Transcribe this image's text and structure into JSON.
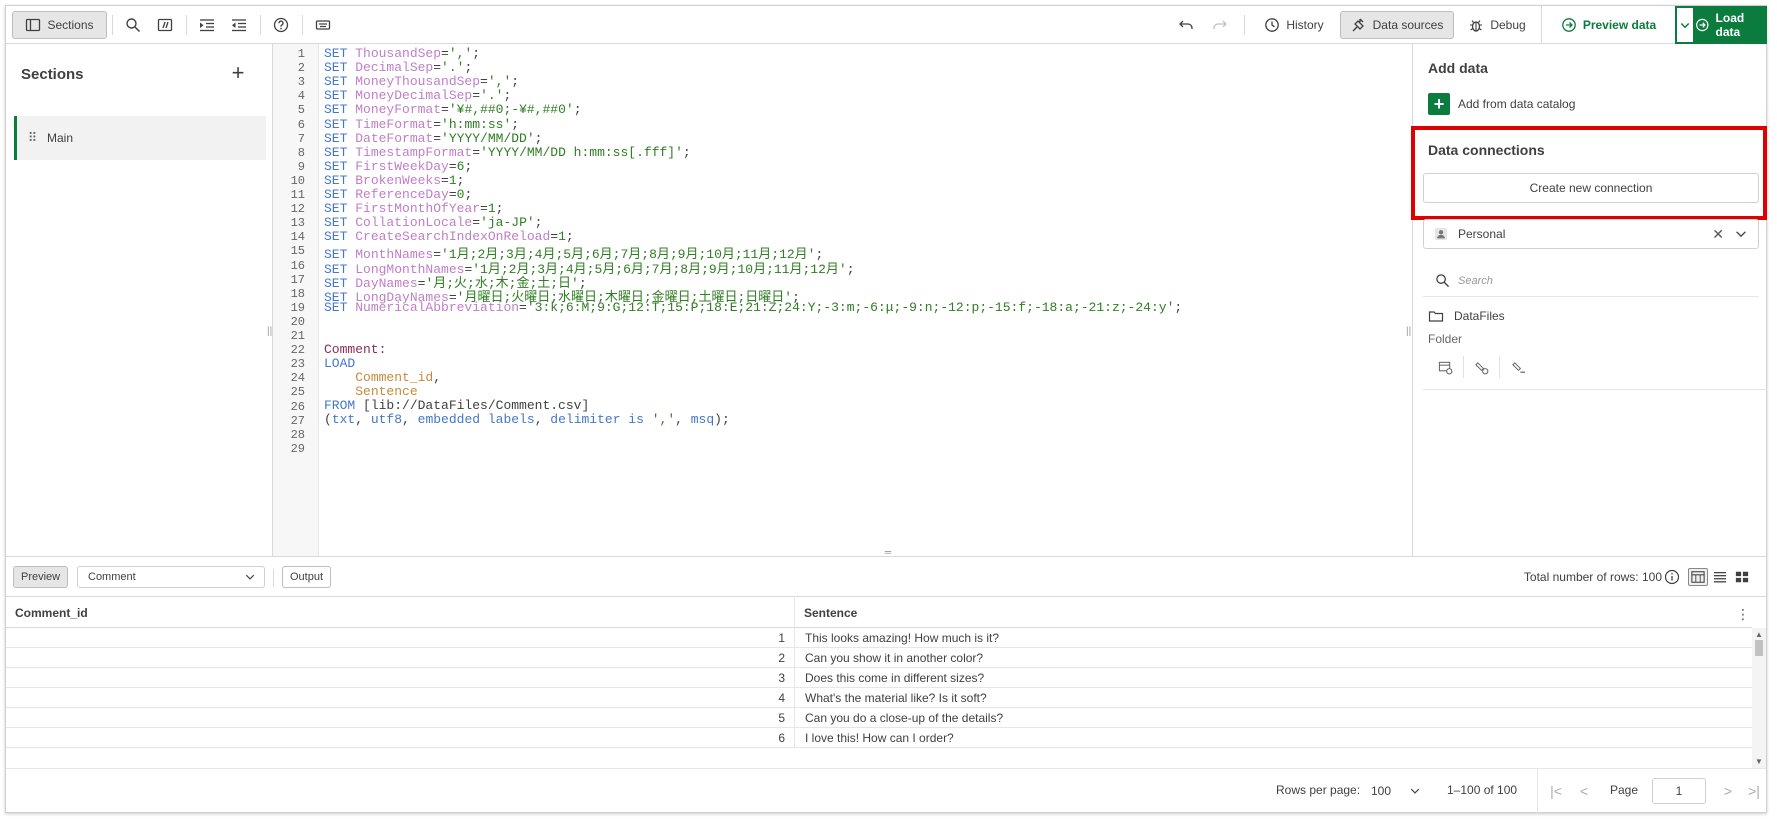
{
  "toolbar": {
    "sections_label": "Sections",
    "history_label": "History",
    "data_sources_label": "Data sources",
    "debug_label": "Debug",
    "preview_data_label": "Preview data",
    "load_data_label": "Load data",
    "accent_color": "#0b7c3e"
  },
  "sections_panel": {
    "title": "Sections",
    "items": [
      {
        "label": "Main"
      }
    ]
  },
  "editor": {
    "line_numbers": [
      "1",
      "2",
      "3",
      "4",
      "5",
      "6",
      "7",
      "8",
      "9",
      "10",
      "11",
      "12",
      "13",
      "14",
      "15",
      "16",
      "17",
      "18",
      "19",
      "20",
      "21",
      "22",
      "23",
      "24",
      "25",
      "26",
      "27",
      "28",
      "29"
    ],
    "lines": [
      {
        "var": "ThousandSep",
        "val": "','"
      },
      {
        "var": "DecimalSep",
        "val": "'.'"
      },
      {
        "var": "MoneyThousandSep",
        "val": "','"
      },
      {
        "var": "MoneyDecimalSep",
        "val": "'.'"
      },
      {
        "var": "MoneyFormat",
        "val": "'¥#,##0;-¥#,##0'"
      },
      {
        "var": "TimeFormat",
        "val": "'h:mm:ss'"
      },
      {
        "var": "DateFormat",
        "val": "'YYYY/MM/DD'"
      },
      {
        "var": "TimestampFormat",
        "val": "'YYYY/MM/DD h:mm:ss[.fff]'"
      },
      {
        "var": "FirstWeekDay",
        "val": "6"
      },
      {
        "var": "BrokenWeeks",
        "val": "1"
      },
      {
        "var": "ReferenceDay",
        "val": "0"
      },
      {
        "var": "FirstMonthOfYear",
        "val": "1"
      },
      {
        "var": "CollationLocale",
        "val": "'ja-JP'"
      },
      {
        "var": "CreateSearchIndexOnReload",
        "val": "1"
      },
      {
        "var": "MonthNames",
        "val": "'1月;2月;3月;4月;5月;6月;7月;8月;9月;10月;11月;12月'"
      },
      {
        "var": "LongMonthNames",
        "val": "'1月;2月;3月;4月;5月;6月;7月;8月;9月;10月;11月;12月'"
      },
      {
        "var": "DayNames",
        "val": "'月;火;水;木;金;土;日'"
      },
      {
        "var": "LongDayNames",
        "val": "'月曜日;火曜日;水曜日;木曜日;金曜日;土曜日;日曜日'"
      },
      {
        "var": "NumericalAbbreviation",
        "val": "'3:k;6:M;9:G;12:T;15:P;18:E;21:Z;24:Y;-3:m;-6:μ;-9:n;-12:p;-15:f;-18:a;-21:z;-24:y'"
      }
    ],
    "kw_set": "SET",
    "eq": "=",
    "semi": ";",
    "comment_label": "Comment:",
    "kw_load": "LOAD",
    "field1": "Comment_id",
    "comma": ",",
    "field2": "Sentence",
    "kw_from": "FROM",
    "from_path": " [lib://DataFiles/Comment.csv]",
    "fmt_open": "(",
    "fmt_txt": "txt",
    "fmt_sep": ", ",
    "fmt_utf8": "utf8",
    "fmt_embedded": "embedded labels",
    "fmt_delim": "delimiter is",
    "fmt_delim_val": " ','",
    "fmt_msq": "msq",
    "fmt_close": ");"
  },
  "data_panel": {
    "add_data_title": "Add data",
    "add_catalog_label": "Add from data catalog",
    "connections_title": "Data connections",
    "create_connection_label": "Create new connection",
    "space_value": "Personal",
    "search_placeholder": "Search",
    "connection_name": "DataFiles",
    "connection_type": "Folder"
  },
  "preview_bar": {
    "preview_label": "Preview",
    "table_select_value": "Comment",
    "output_label": "Output",
    "total_rows_text": "Total number of rows: 100"
  },
  "table": {
    "columns": [
      "Comment_id",
      "Sentence"
    ],
    "rows": [
      {
        "id": "1",
        "sentence": "This looks amazing! How much is it?"
      },
      {
        "id": "2",
        "sentence": "Can you show it in another color?"
      },
      {
        "id": "3",
        "sentence": "Does this come in different sizes?"
      },
      {
        "id": "4",
        "sentence": "What's the material like? Is it soft?"
      },
      {
        "id": "5",
        "sentence": "Can you do a close-up of the details?"
      },
      {
        "id": "6",
        "sentence": "I love this! How can I order?"
      }
    ]
  },
  "pager": {
    "rows_per_page_label": "Rows per page:",
    "rows_per_page_value": "100",
    "range_text": "1–100 of 100",
    "page_label": "Page",
    "page_value": "1"
  }
}
